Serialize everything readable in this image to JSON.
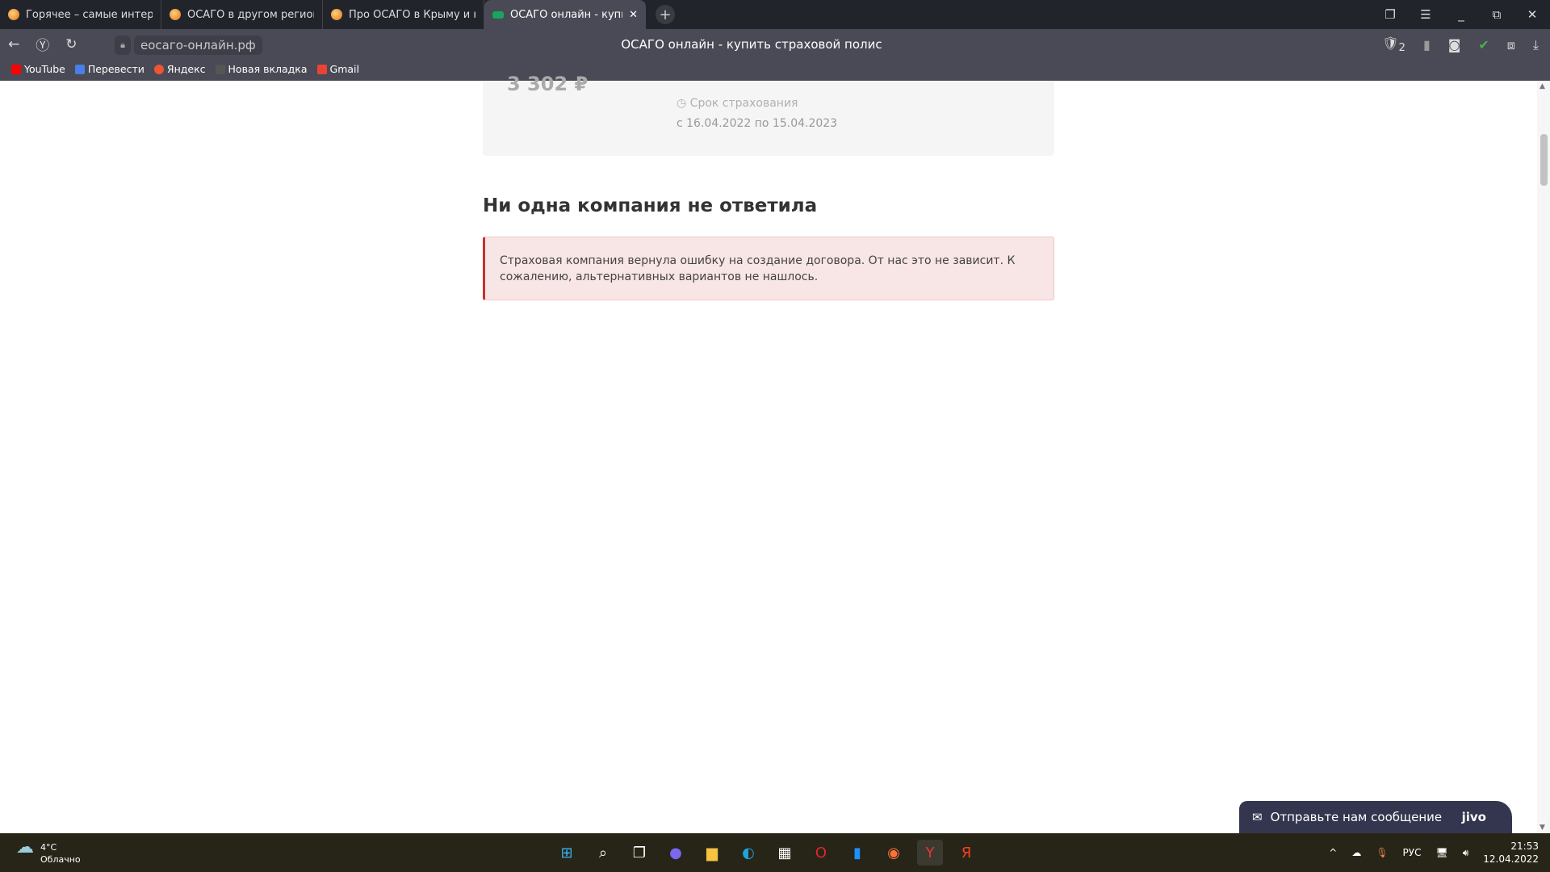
{
  "browser": {
    "tabs": [
      {
        "label": "Горячее – самые интересные",
        "active": false
      },
      {
        "label": "ОСАГО в другом регионе",
        "active": false
      },
      {
        "label": "Про ОСАГО в Крыму и не",
        "active": false
      },
      {
        "label": "ОСАГО онлайн - купить",
        "active": true
      }
    ],
    "url": "еосаго-онлайн.рф",
    "page_title": "ОСАГО онлайн - купить страховой полис",
    "protect_badge": "2",
    "bookmarks": [
      "YouTube",
      "Перевести",
      "Яндекс",
      "Новая вкладка",
      "Gmail"
    ]
  },
  "page": {
    "price": "3 302 ₽",
    "term_label": "Срок страхования",
    "term_dates": "с 16.04.2022 по 15.04.2023",
    "heading": "Ни одна компания не ответила",
    "alert": "Страховая компания вернула ошибку на создание договора. От нас это не зависит. К сожалению, альтернативных вариантов не нашлось.",
    "alert_color": "#c9302c"
  },
  "chat": {
    "label": "Отправьте нам сообщение",
    "brand": "jivo"
  },
  "taskbar": {
    "temp": "4°C",
    "weather": "Облачно",
    "lang": "РУС",
    "time": "21:53",
    "date": "12.04.2022"
  }
}
